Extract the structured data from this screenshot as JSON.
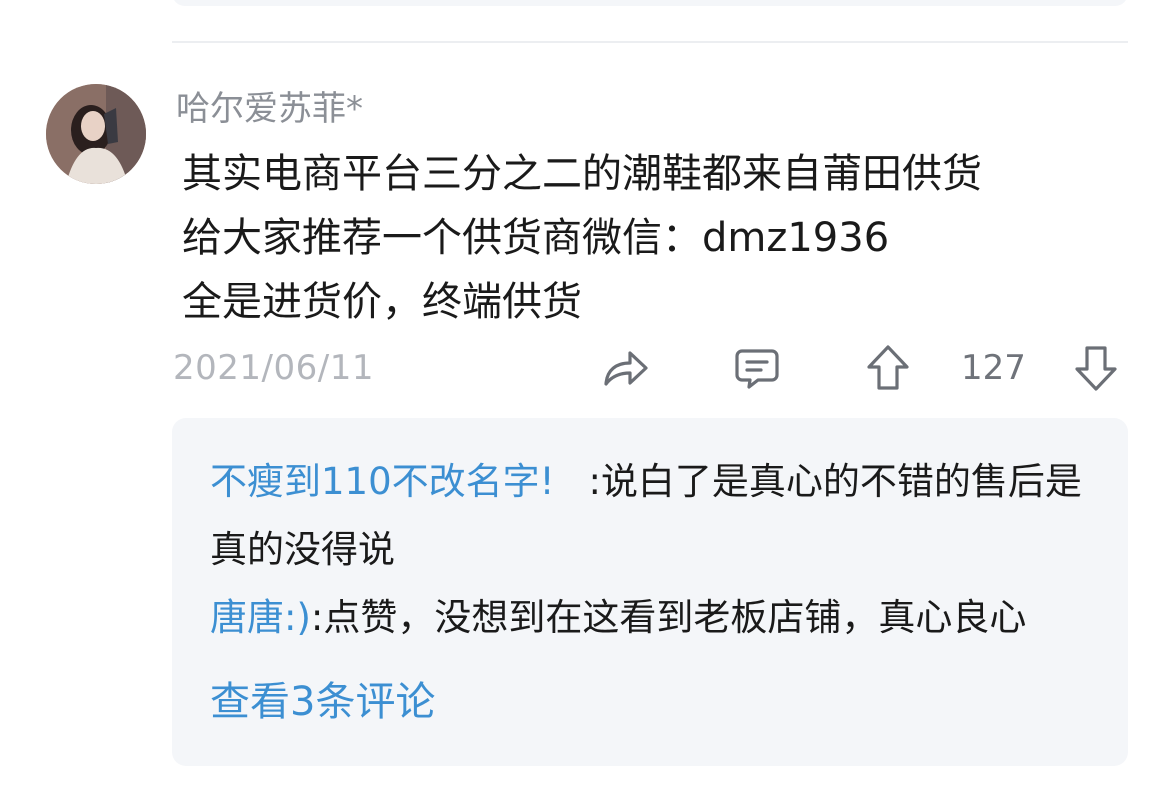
{
  "post": {
    "username": "哈尔爱苏菲*",
    "content_lines": [
      "其实电商平台三分之二的潮鞋都来自莆田供货",
      "给大家推荐一个供货商微信：dmz1936",
      "全是进货价，终端供货"
    ],
    "date": "2021/06/11",
    "vote_count": "127",
    "icons": {
      "share": "share-icon",
      "comment": "comment-icon",
      "upvote": "upvote-icon",
      "downvote": "downvote-icon"
    }
  },
  "replies": [
    {
      "author": "不瘦到110不改名字!",
      "separator": ":",
      "text": "说白了是真心的不错的售后是真的没得说"
    },
    {
      "author": "唐唐:)",
      "separator": ":",
      "text": "点赞，没想到在这看到老板店铺，真心良心"
    }
  ],
  "view_more_label": "查看3条评论",
  "colors": {
    "link_blue": "#3c8fd2",
    "meta_gray": "#b3b6bc",
    "username_gray": "#8b8f96",
    "reply_bg": "#f4f6f9"
  }
}
